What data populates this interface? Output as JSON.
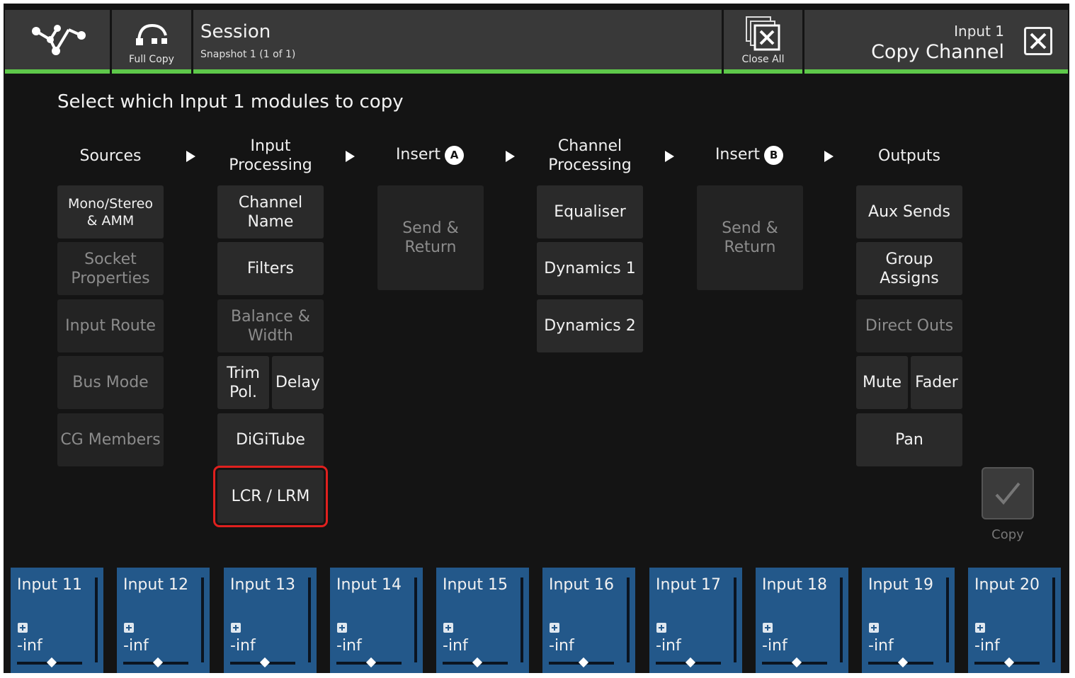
{
  "topbar": {
    "full_copy_label": "Full Copy",
    "session_title": "Session",
    "session_sub": "Snapshot 1 (1 of 1)",
    "close_all_label": "Close All",
    "title_sub": "Input 1",
    "title_main": "Copy Channel"
  },
  "prompt": "Select which Input 1 modules to copy",
  "columns": {
    "sources": "Sources",
    "input_processing": "Input\nProcessing",
    "insert_a": "Insert",
    "insert_a_badge": "A",
    "channel_processing": "Channel\nProcessing",
    "insert_b": "Insert",
    "insert_b_badge": "B",
    "outputs": "Outputs"
  },
  "modules": {
    "mono_stereo": "Mono/Stereo\n& AMM",
    "socket_properties": "Socket\nProperties",
    "input_route": "Input Route",
    "bus_mode": "Bus Mode",
    "cg_members": "CG Members",
    "channel_name": "Channel\nName",
    "filters": "Filters",
    "balance_width": "Balance &\nWidth",
    "trim_pol": "Trim\nPol.",
    "delay": "Delay",
    "digitube": "DiGiTube",
    "lcr_lrm": "LCR / LRM",
    "send_return_a": "Send &\nReturn",
    "equaliser": "Equaliser",
    "dynamics_1": "Dynamics 1",
    "dynamics_2": "Dynamics 2",
    "send_return_b": "Send &\nReturn",
    "aux_sends": "Aux Sends",
    "group_assigns": "Group\nAssigns",
    "direct_outs": "Direct Outs",
    "mute": "Mute",
    "fader": "Fader",
    "pan": "Pan"
  },
  "copy_label": "Copy",
  "strips": [
    {
      "name": "Input 11",
      "value": "-inf"
    },
    {
      "name": "Input 12",
      "value": "-inf"
    },
    {
      "name": "Input 13",
      "value": "-inf"
    },
    {
      "name": "Input 14",
      "value": "-inf"
    },
    {
      "name": "Input 15",
      "value": "-inf"
    },
    {
      "name": "Input 16",
      "value": "-inf"
    },
    {
      "name": "Input 17",
      "value": "-inf"
    },
    {
      "name": "Input 18",
      "value": "-inf"
    },
    {
      "name": "Input 19",
      "value": "-inf"
    },
    {
      "name": "Input 20",
      "value": "-inf"
    }
  ],
  "colors": {
    "accent_green": "#5ec84a",
    "strip_blue": "#23588a",
    "highlight_red": "#e0201e"
  }
}
